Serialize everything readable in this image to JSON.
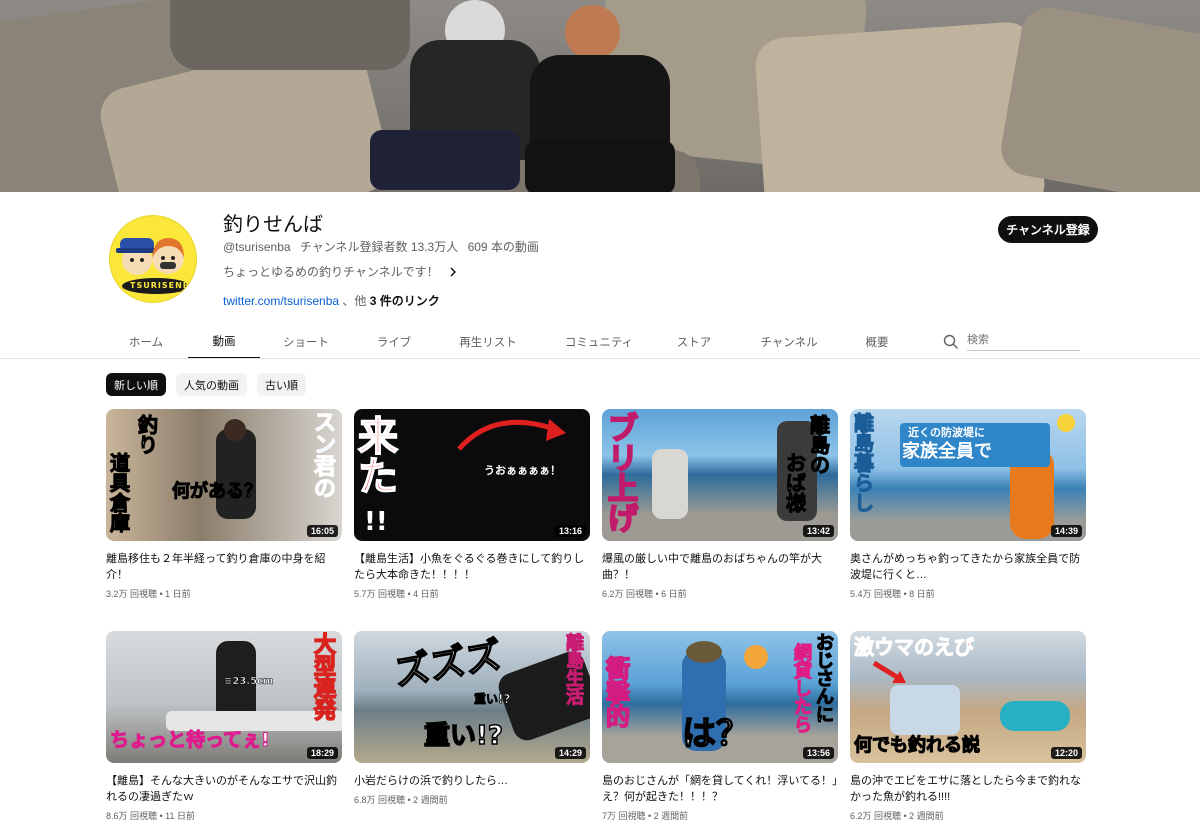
{
  "channel": {
    "name": "釣りせんば",
    "handle": "@tsurisenba",
    "subscribers": "チャンネル登録者数 13.3万人",
    "video_count": "609 本の動画",
    "description": "ちょっとゆるめの釣りチャンネルです！",
    "link_text": "twitter.com/tsurisenba",
    "link_more_prefix": "、他",
    "link_more_count": "3 件のリンク",
    "subscribe_label": "チャンネル登録",
    "avatar_text": "TSURISENBA"
  },
  "tabs": [
    "ホーム",
    "動画",
    "ショート",
    "ライブ",
    "再生リスト",
    "コミュニティ",
    "ストア",
    "チャンネル",
    "概要"
  ],
  "active_tab": "動画",
  "search": {
    "placeholder": "検索"
  },
  "chips": [
    "新しい順",
    "人気の動画",
    "古い順"
  ],
  "videos": [
    {
      "title": "離島移住も２年半経って釣り倉庫の中身を紹介！",
      "views": "3.2万 回視聴",
      "age": "1 日前",
      "duration": "16:05",
      "thumb_text": [
        "釣り",
        "道具倉庫",
        "何がある？",
        "スン君の"
      ]
    },
    {
      "title": "【離島生活】小魚をぐるぐる巻きにして釣りしたら大本命きた！！！！",
      "views": "5.7万 回視聴",
      "age": "4 日前",
      "duration": "13:16",
      "thumb_text": [
        "来た",
        "!!",
        "うおぁぁぁぁ！"
      ]
    },
    {
      "title": "爆風の厳しい中で離島のおばちゃんの竿が大曲？！",
      "views": "6.2万 回視聴",
      "age": "6 日前",
      "duration": "13:42",
      "thumb_text": [
        "ブリ上げ",
        "離島の",
        "おば様"
      ]
    },
    {
      "title": "奥さんがめっちゃ釣ってきたから家族全員で防波堤に行くと…",
      "views": "5.4万 回視聴",
      "age": "8 日前",
      "duration": "14:39",
      "thumb_text": [
        "離島暮らし",
        "近くの防波堤に",
        "家族全員で"
      ]
    },
    {
      "title": "【離島】そんな大きいのがそんなエサで沢山釣れるの凄過ぎたｗ",
      "views": "8.6万 回視聴",
      "age": "11 日前",
      "duration": "18:29",
      "thumb_text": [
        "大型連発",
        "ちょっと待ってぇ!",
        "≡23.5cm"
      ]
    },
    {
      "title": "小岩だらけの浜で釣りしたら…",
      "views": "6.8万 回視聴",
      "age": "2 週間前",
      "duration": "14:29",
      "thumb_text": [
        "離島生活",
        "ズズズ",
        "重い!?",
        "重い!?"
      ]
    },
    {
      "title": "島のおじさんが「網を貸してくれ！浮いてる！」え？何が起きた！！！？",
      "views": "7万 回視聴",
      "age": "2 週間前",
      "duration": "13:56",
      "thumb_text": [
        "衝撃的",
        "は？",
        "おじさんに",
        "網貸したら"
      ]
    },
    {
      "title": "島の沖でエビをエサに落としたら今まで釣れなかった魚が釣れる!!!!",
      "views": "6.2万 回視聴",
      "age": "2 週間前",
      "duration": "12:20",
      "thumb_text": [
        "激ウマのえび",
        "何でも釣れる説"
      ]
    }
  ]
}
